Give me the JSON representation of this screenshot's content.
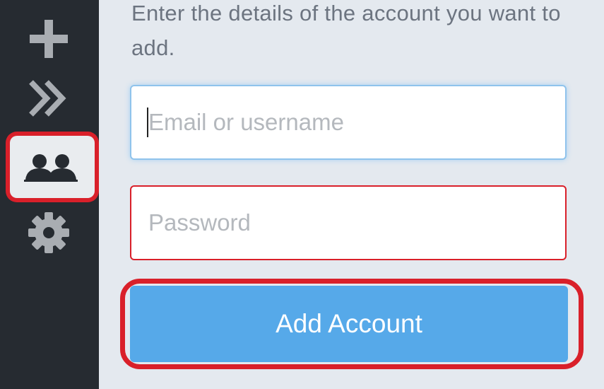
{
  "sidebar": {
    "items": [
      {
        "name": "add",
        "icon": "plus-icon"
      },
      {
        "name": "collapse",
        "icon": "double-chevron-right-icon"
      },
      {
        "name": "accounts",
        "icon": "users-icon",
        "highlighted": true
      },
      {
        "name": "settings",
        "icon": "gear-icon"
      }
    ]
  },
  "form": {
    "instructions": "Enter the details of the account you want to add.",
    "email_placeholder": "Email or username",
    "email_value": "",
    "password_placeholder": "Password",
    "password_value": "",
    "submit_label": "Add Account"
  },
  "colors": {
    "sidebar_bg": "#262b31",
    "panel_bg": "#e4e9ef",
    "button_bg": "#56a9e9",
    "highlight_red": "#d9202a"
  }
}
